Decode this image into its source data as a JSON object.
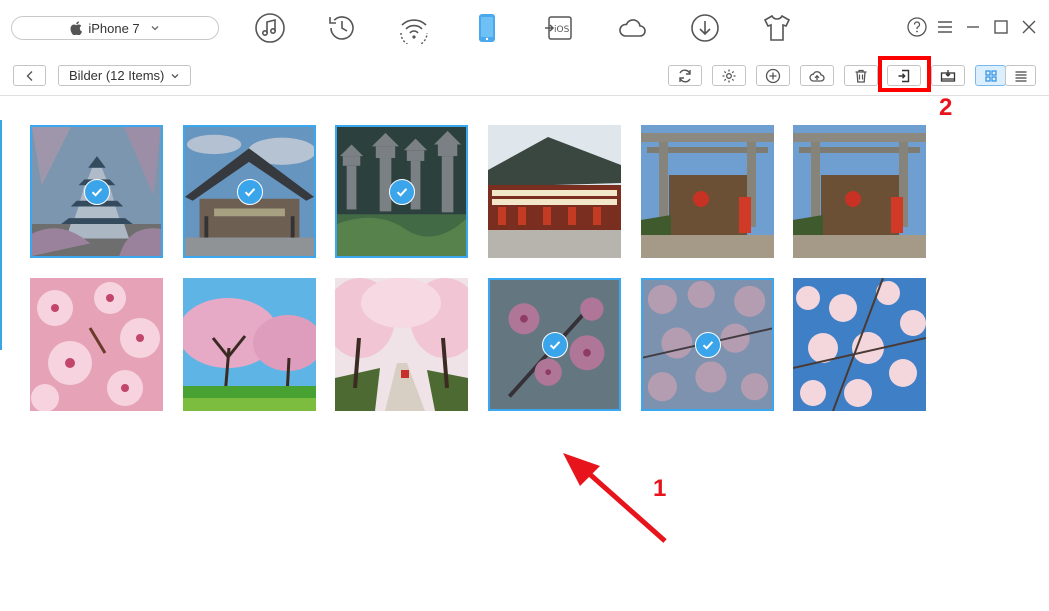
{
  "device": {
    "name": "iPhone 7"
  },
  "album": {
    "title": "Bilder (12 Items)"
  },
  "top_icons": [
    "music-icon",
    "history-icon",
    "wifi-sync-icon",
    "phone-icon",
    "ios-mover-icon",
    "cloud-icon",
    "download-icon",
    "tshirt-icon"
  ],
  "ios_label": "iOS",
  "toolbar": {
    "buttons": [
      "refresh-icon",
      "settings-icon",
      "add-icon",
      "cloud-upload-icon",
      "delete-icon",
      "send-to-computer-icon",
      "send-to-device-icon",
      "grid-view-icon",
      "list-view-icon"
    ]
  },
  "annotations": {
    "step1": "1",
    "step2": "2"
  },
  "photos": [
    {
      "subject": "castle",
      "selected": true
    },
    {
      "subject": "shrine",
      "selected": true
    },
    {
      "subject": "lanterns",
      "selected": true
    },
    {
      "subject": "temple",
      "selected": false
    },
    {
      "subject": "torii",
      "selected": false
    },
    {
      "subject": "torii",
      "selected": false
    },
    {
      "subject": "blossom-closeup",
      "selected": false
    },
    {
      "subject": "blossom-trees",
      "selected": false
    },
    {
      "subject": "blossom-path",
      "selected": false
    },
    {
      "subject": "blossom-branch",
      "selected": true
    },
    {
      "subject": "blossom-cluster",
      "selected": true
    },
    {
      "subject": "blossom-sky",
      "selected": false
    }
  ],
  "colors": {
    "accent": "#3aa5ea",
    "highlight": "#ff0000",
    "arrow": "#e8141b"
  }
}
